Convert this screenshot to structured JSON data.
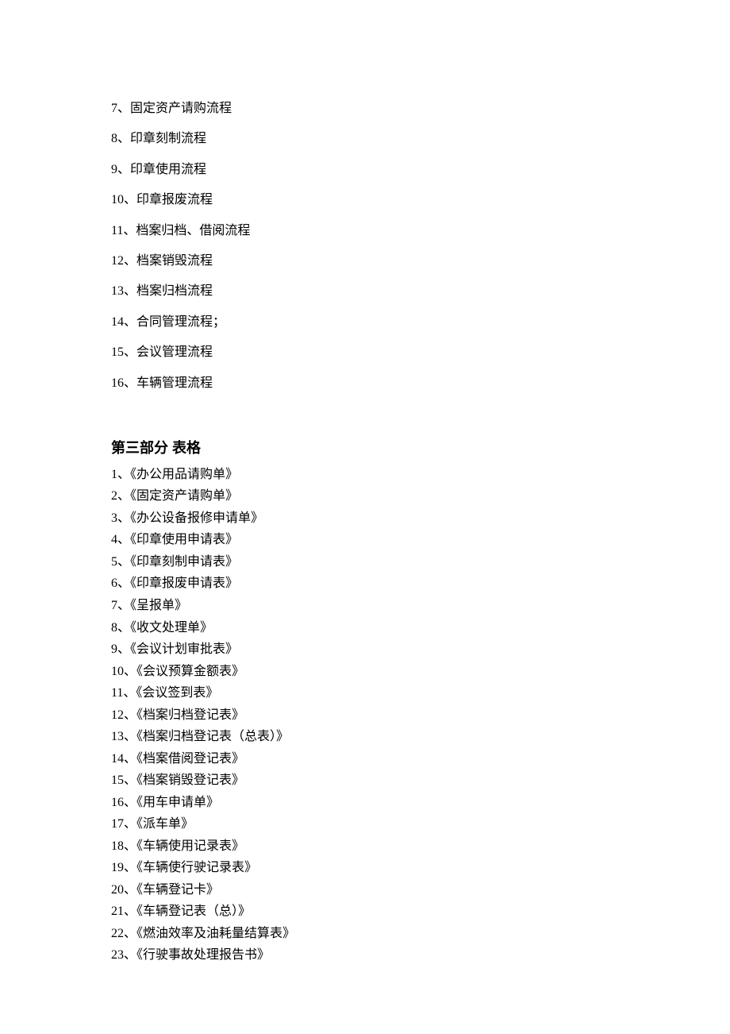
{
  "processes": [
    {
      "num": "7",
      "label": "固定资产请购流程"
    },
    {
      "num": "8",
      "label": "印章刻制流程"
    },
    {
      "num": "9",
      "label": "印章使用流程"
    },
    {
      "num": "10",
      "label": "印章报废流程"
    },
    {
      "num": "11",
      "label": "档案归档、借阅流程"
    },
    {
      "num": "12",
      "label": "档案销毁流程"
    },
    {
      "num": "13",
      "label": "档案归档流程"
    },
    {
      "num": "14",
      "label": "合同管理流程；"
    },
    {
      "num": "15",
      "label": "会议管理流程"
    },
    {
      "num": "16",
      "label": "车辆管理流程"
    }
  ],
  "section3_heading": "第三部分  表格",
  "forms": [
    {
      "num": "1",
      "label": "《办公用品请购单》"
    },
    {
      "num": "2",
      "label": "《固定资产请购单》"
    },
    {
      "num": "3",
      "label": "《办公设备报修申请单》"
    },
    {
      "num": "4",
      "label": "《印章使用申请表》"
    },
    {
      "num": "5",
      "label": "《印章刻制申请表》"
    },
    {
      "num": "6",
      "label": "《印章报废申请表》"
    },
    {
      "num": "7",
      "label": "《呈报单》"
    },
    {
      "num": "8",
      "label": "《收文处理单》"
    },
    {
      "num": "9",
      "label": "《会议计划审批表》"
    },
    {
      "num": "10",
      "label": "《会议预算金额表》"
    },
    {
      "num": "11",
      "label": "《会议签到表》"
    },
    {
      "num": "12",
      "label": "《档案归档登记表》"
    },
    {
      "num": "13",
      "label": "《档案归档登记表（总表）》"
    },
    {
      "num": "14",
      "label": "《档案借阅登记表》"
    },
    {
      "num": "15",
      "label": "《档案销毁登记表》"
    },
    {
      "num": "16",
      "label": "《用车申请单》"
    },
    {
      "num": "17",
      "label": "《派车单》"
    },
    {
      "num": "18",
      "label": "《车辆使用记录表》"
    },
    {
      "num": "19",
      "label": "《车辆使行驶记录表》"
    },
    {
      "num": "20",
      "label": "《车辆登记卡》"
    },
    {
      "num": "21",
      "label": "《车辆登记表（总）》"
    },
    {
      "num": "22",
      "label": "《燃油效率及油耗量结算表》"
    },
    {
      "num": "23",
      "label": "《行驶事故处理报告书》"
    }
  ]
}
